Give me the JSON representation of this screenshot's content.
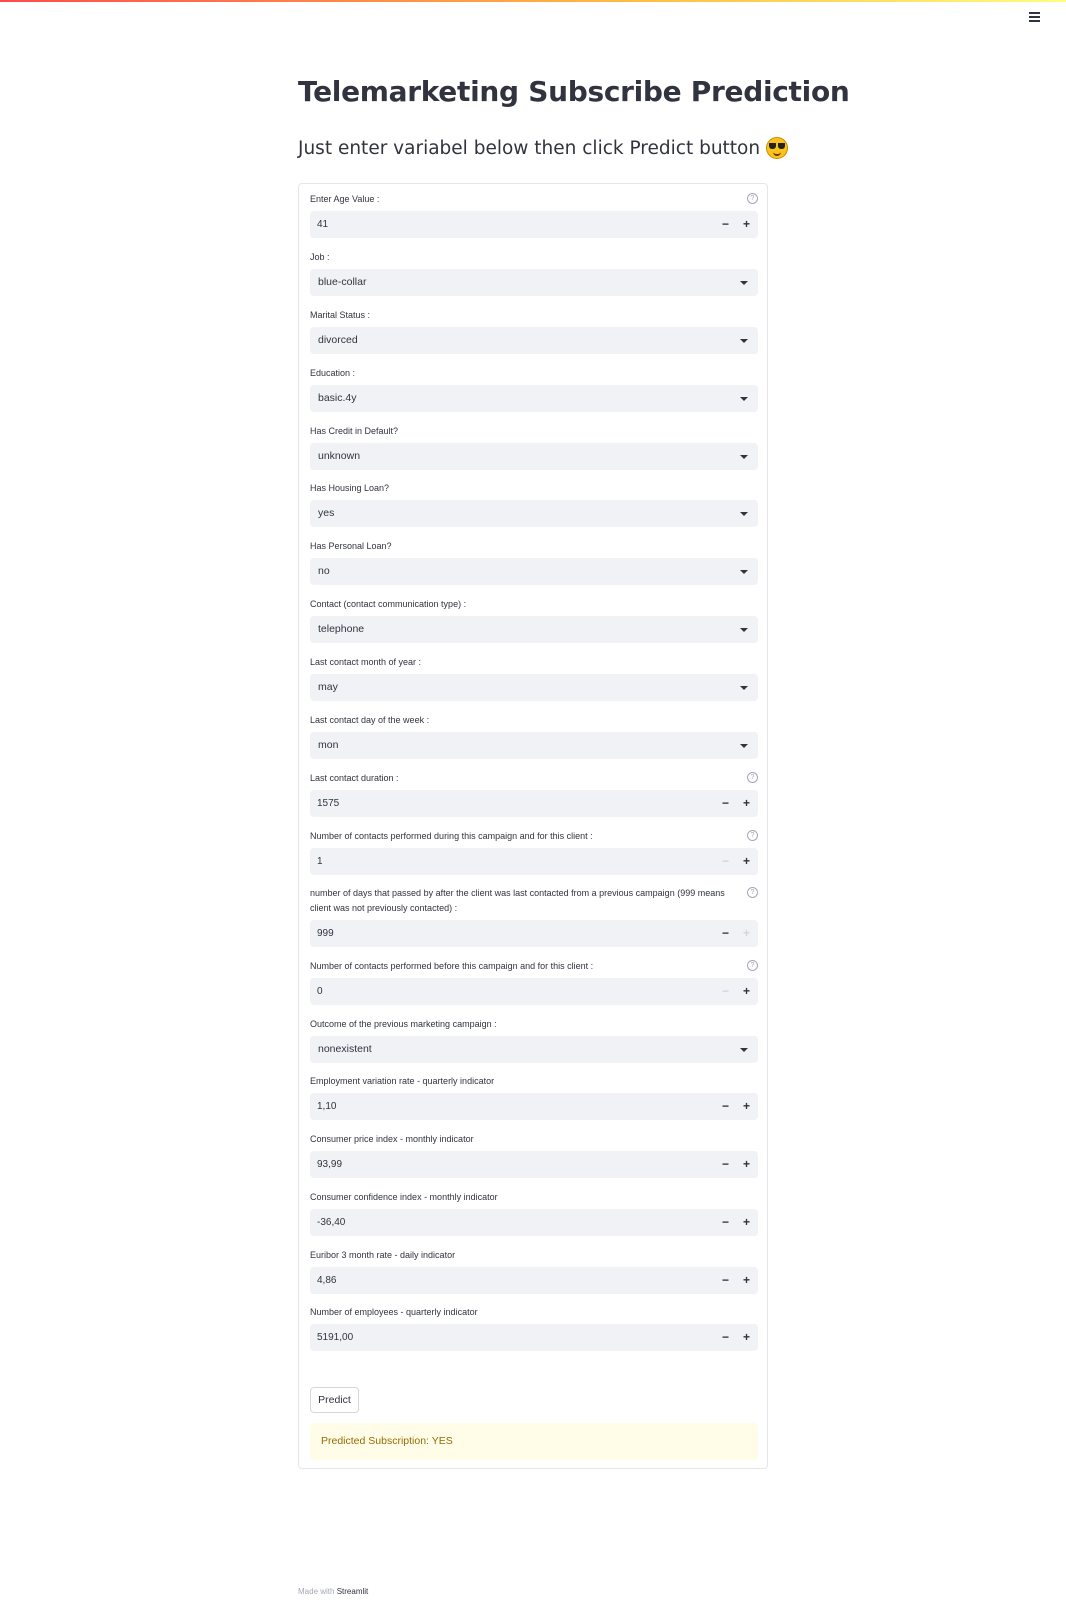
{
  "page": {
    "title": "Telemarketing Subscribe Prediction",
    "subtitle": "Just enter variabel below then click Predict button"
  },
  "form": {
    "fields": [
      {
        "type": "number",
        "label": "Enter Age Value :",
        "value": "41",
        "help": true,
        "minus_disabled": false,
        "plus_disabled": false
      },
      {
        "type": "select",
        "label": "Job :",
        "value": "blue-collar"
      },
      {
        "type": "select",
        "label": "Marital Status :",
        "value": "divorced"
      },
      {
        "type": "select",
        "label": "Education :",
        "value": "basic.4y"
      },
      {
        "type": "select",
        "label": "Has Credit in Default?",
        "value": "unknown"
      },
      {
        "type": "select",
        "label": "Has Housing Loan?",
        "value": "yes"
      },
      {
        "type": "select",
        "label": "Has Personal Loan?",
        "value": "no"
      },
      {
        "type": "select",
        "label": "Contact (contact communication type) :",
        "value": "telephone"
      },
      {
        "type": "select",
        "label": "Last contact month of year :",
        "value": "may"
      },
      {
        "type": "select",
        "label": "Last contact day of the week :",
        "value": "mon"
      },
      {
        "type": "number",
        "label": "Last contact duration :",
        "value": "1575",
        "help": true,
        "minus_disabled": false,
        "plus_disabled": false
      },
      {
        "type": "number",
        "label": "Number of contacts performed during this campaign and for this client :",
        "value": "1",
        "help": true,
        "minus_disabled": true,
        "plus_disabled": false
      },
      {
        "type": "number",
        "label": "number of days that passed by after the client was last contacted from a previous campaign (999 means client was not previously contacted) :",
        "value": "999",
        "help": true,
        "minus_disabled": false,
        "plus_disabled": true
      },
      {
        "type": "number",
        "label": "Number of contacts performed before this campaign and for this client :",
        "value": "0",
        "help": true,
        "minus_disabled": true,
        "plus_disabled": false
      },
      {
        "type": "select",
        "label": "Outcome of the previous marketing campaign :",
        "value": "nonexistent"
      },
      {
        "type": "number",
        "label": "Employment variation rate - quarterly indicator",
        "value": "1,10",
        "help": false,
        "minus_disabled": false,
        "plus_disabled": false
      },
      {
        "type": "number",
        "label": "Consumer price index - monthly indicator",
        "value": "93,99",
        "help": false,
        "minus_disabled": false,
        "plus_disabled": false
      },
      {
        "type": "number",
        "label": "Consumer confidence index - monthly indicator",
        "value": "-36,40",
        "help": false,
        "minus_disabled": false,
        "plus_disabled": false
      },
      {
        "type": "number",
        "label": "Euribor 3 month rate - daily indicator",
        "value": "4,86",
        "help": false,
        "minus_disabled": false,
        "plus_disabled": false
      },
      {
        "type": "number",
        "label": "Number of employees - quarterly indicator",
        "value": "5191,00",
        "help": false,
        "minus_disabled": false,
        "plus_disabled": false
      }
    ],
    "help_glyph": "?",
    "minus_glyph": "−",
    "plus_glyph": "+",
    "predict_label": "Predict"
  },
  "result": {
    "text": "Predicted Subscription: YES"
  },
  "footer": {
    "made_with": "Made with",
    "brand": "Streamlit"
  },
  "icons": {
    "menu": "hamburger-menu-icon",
    "emoji": "smiling-face-with-sunglasses",
    "help": "question-circle-icon",
    "dropdown": "chevron-down-icon"
  }
}
